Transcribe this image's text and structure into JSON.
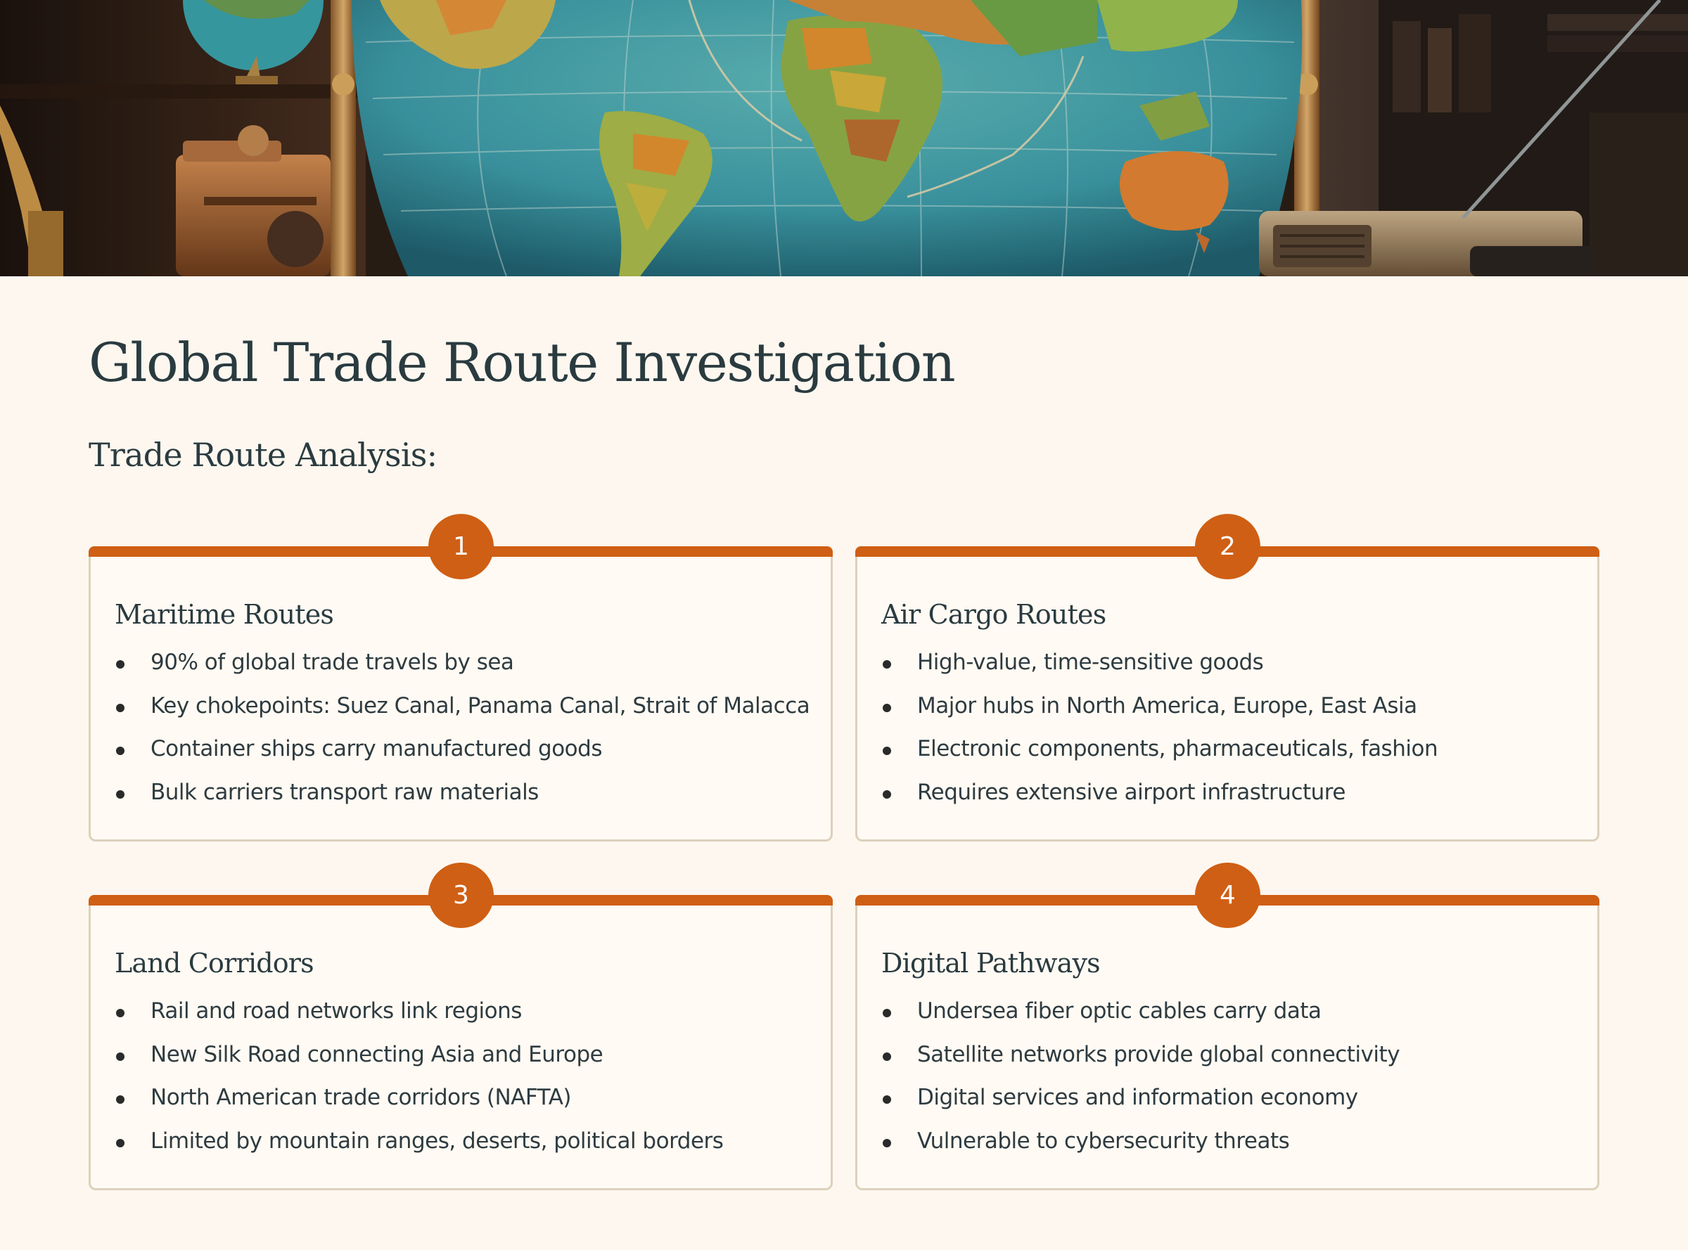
{
  "page": {
    "title": "Global Trade Route Investigation",
    "section_heading": "Trade Route Analysis:"
  },
  "colors": {
    "accent": "#cf5f14",
    "background": "#fdf7ef",
    "card_border": "#ddd0bc",
    "heading_text": "#2a3b40"
  },
  "hero": {
    "image": "vintage-world-globe-illustration"
  },
  "cards": [
    {
      "number": "1",
      "title": "Maritime Routes",
      "items": [
        "90% of global trade travels by sea",
        "Key chokepoints: Suez Canal, Panama Canal, Strait of Malacca",
        "Container ships carry manufactured goods",
        "Bulk carriers transport raw materials"
      ]
    },
    {
      "number": "2",
      "title": "Air Cargo Routes",
      "items": [
        "High-value, time-sensitive goods",
        "Major hubs in North America, Europe, East Asia",
        "Electronic components, pharmaceuticals, fashion",
        "Requires extensive airport infrastructure"
      ]
    },
    {
      "number": "3",
      "title": "Land Corridors",
      "items": [
        "Rail and road networks link regions",
        "New Silk Road connecting Asia and Europe",
        "North American trade corridors (NAFTA)",
        "Limited by mountain ranges, deserts, political borders"
      ]
    },
    {
      "number": "4",
      "title": "Digital Pathways",
      "items": [
        "Undersea fiber optic cables carry data",
        "Satellite networks provide global connectivity",
        "Digital services and information economy",
        "Vulnerable to cybersecurity threats"
      ]
    }
  ]
}
